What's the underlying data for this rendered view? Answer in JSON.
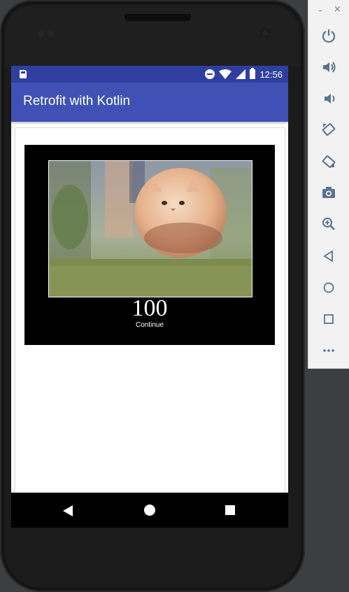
{
  "status_bar": {
    "time": "12:56"
  },
  "app_bar": {
    "title": "Retrofit with Kotlin"
  },
  "meme": {
    "number": "100",
    "caption": "Continue"
  },
  "emulator_toolbar": {
    "window_controls": {
      "minimize": "–",
      "close": "×"
    },
    "buttons": [
      "power-icon",
      "volume-up-icon",
      "volume-down-icon",
      "rotate-left-icon",
      "rotate-right-icon",
      "screenshot-icon",
      "zoom-icon",
      "back-icon",
      "home-icon",
      "overview-icon",
      "more-icon"
    ]
  },
  "colors": {
    "status_bar": "#303f9f",
    "app_bar": "#3f51b5",
    "toolbar_icon": "#5a7390"
  }
}
